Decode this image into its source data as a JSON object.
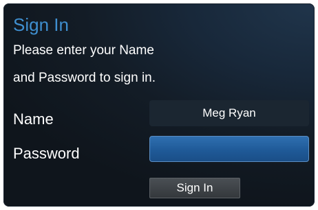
{
  "dialog": {
    "title": "Sign In",
    "message_line1": "Please enter your Name",
    "message_line2": "and Password to sign in."
  },
  "form": {
    "name_label": "Name",
    "name_value": "Meg Ryan",
    "password_label": "Password",
    "password_value": "",
    "submit_label": "Sign In"
  },
  "colors": {
    "title": "#3f8fd0",
    "focused_field": "#1f5a98",
    "background": "#131c26"
  }
}
